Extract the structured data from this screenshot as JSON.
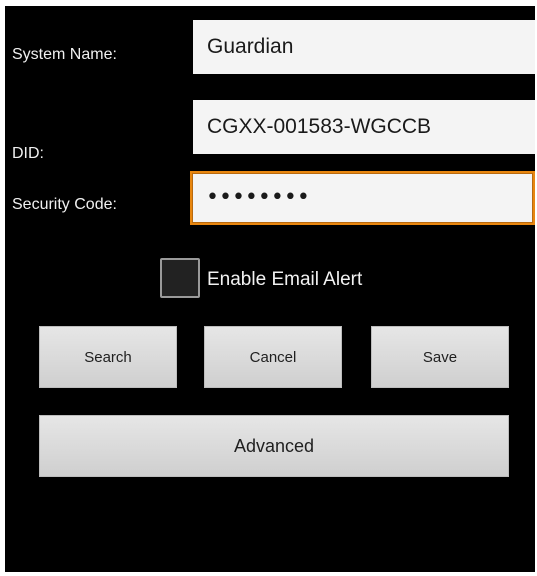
{
  "form": {
    "system_name_label": "System Name:",
    "system_name_value": "Guardian",
    "did_label": "DID:",
    "did_value": "CGXX-001583-WGCCB",
    "security_code_label": "Security Code:",
    "security_code_value": "••••••••"
  },
  "email_alert": {
    "label": "Enable Email Alert",
    "checked": false
  },
  "buttons": {
    "search": "Search",
    "cancel": "Cancel",
    "save": "Save",
    "advanced": "Advanced"
  },
  "colors": {
    "background": "#000000",
    "field_background": "#f4f4f4",
    "focus_border": "#e8860f",
    "button_background": "#dcdcdc"
  }
}
